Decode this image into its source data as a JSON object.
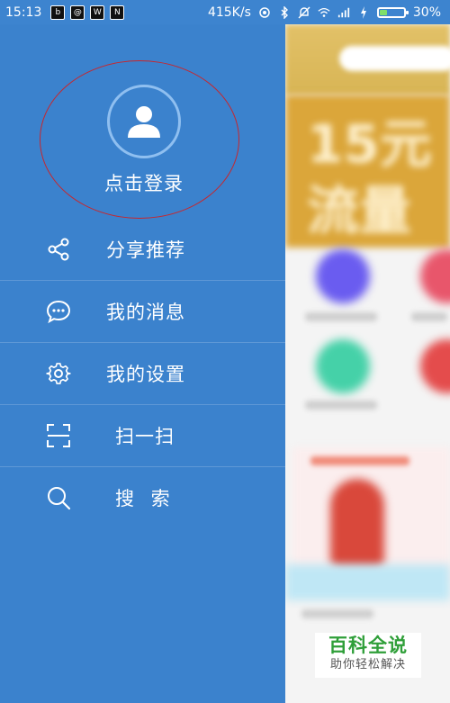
{
  "status_bar": {
    "time": "15:13",
    "notifications": [
      "b",
      "@",
      "W",
      "N"
    ],
    "speed": "415K/s",
    "battery_text": "30%",
    "battery_level": 0.3,
    "icons": [
      "eye-icon",
      "bluetooth-icon",
      "mute-icon",
      "wifi-icon",
      "signal-icon",
      "charging-icon"
    ]
  },
  "drawer": {
    "login_label": "点击登录",
    "menu": [
      {
        "icon": "share-icon",
        "label": "分享推荐"
      },
      {
        "icon": "message-icon",
        "label": "我的消息"
      },
      {
        "icon": "settings-icon",
        "label": "我的设置"
      },
      {
        "icon": "scan-icon",
        "label": "扫一扫"
      },
      {
        "icon": "search-icon",
        "label": "搜 索"
      }
    ]
  },
  "backdrop": {
    "banner_text": "15元\n流量"
  },
  "watermark": {
    "title": "百科全说",
    "subtitle": "助你轻松解决"
  },
  "colors": {
    "drawer_bg": "#3b82cd",
    "annotation_ring": "#c8262c",
    "watermark_green": "#2f9f39"
  }
}
